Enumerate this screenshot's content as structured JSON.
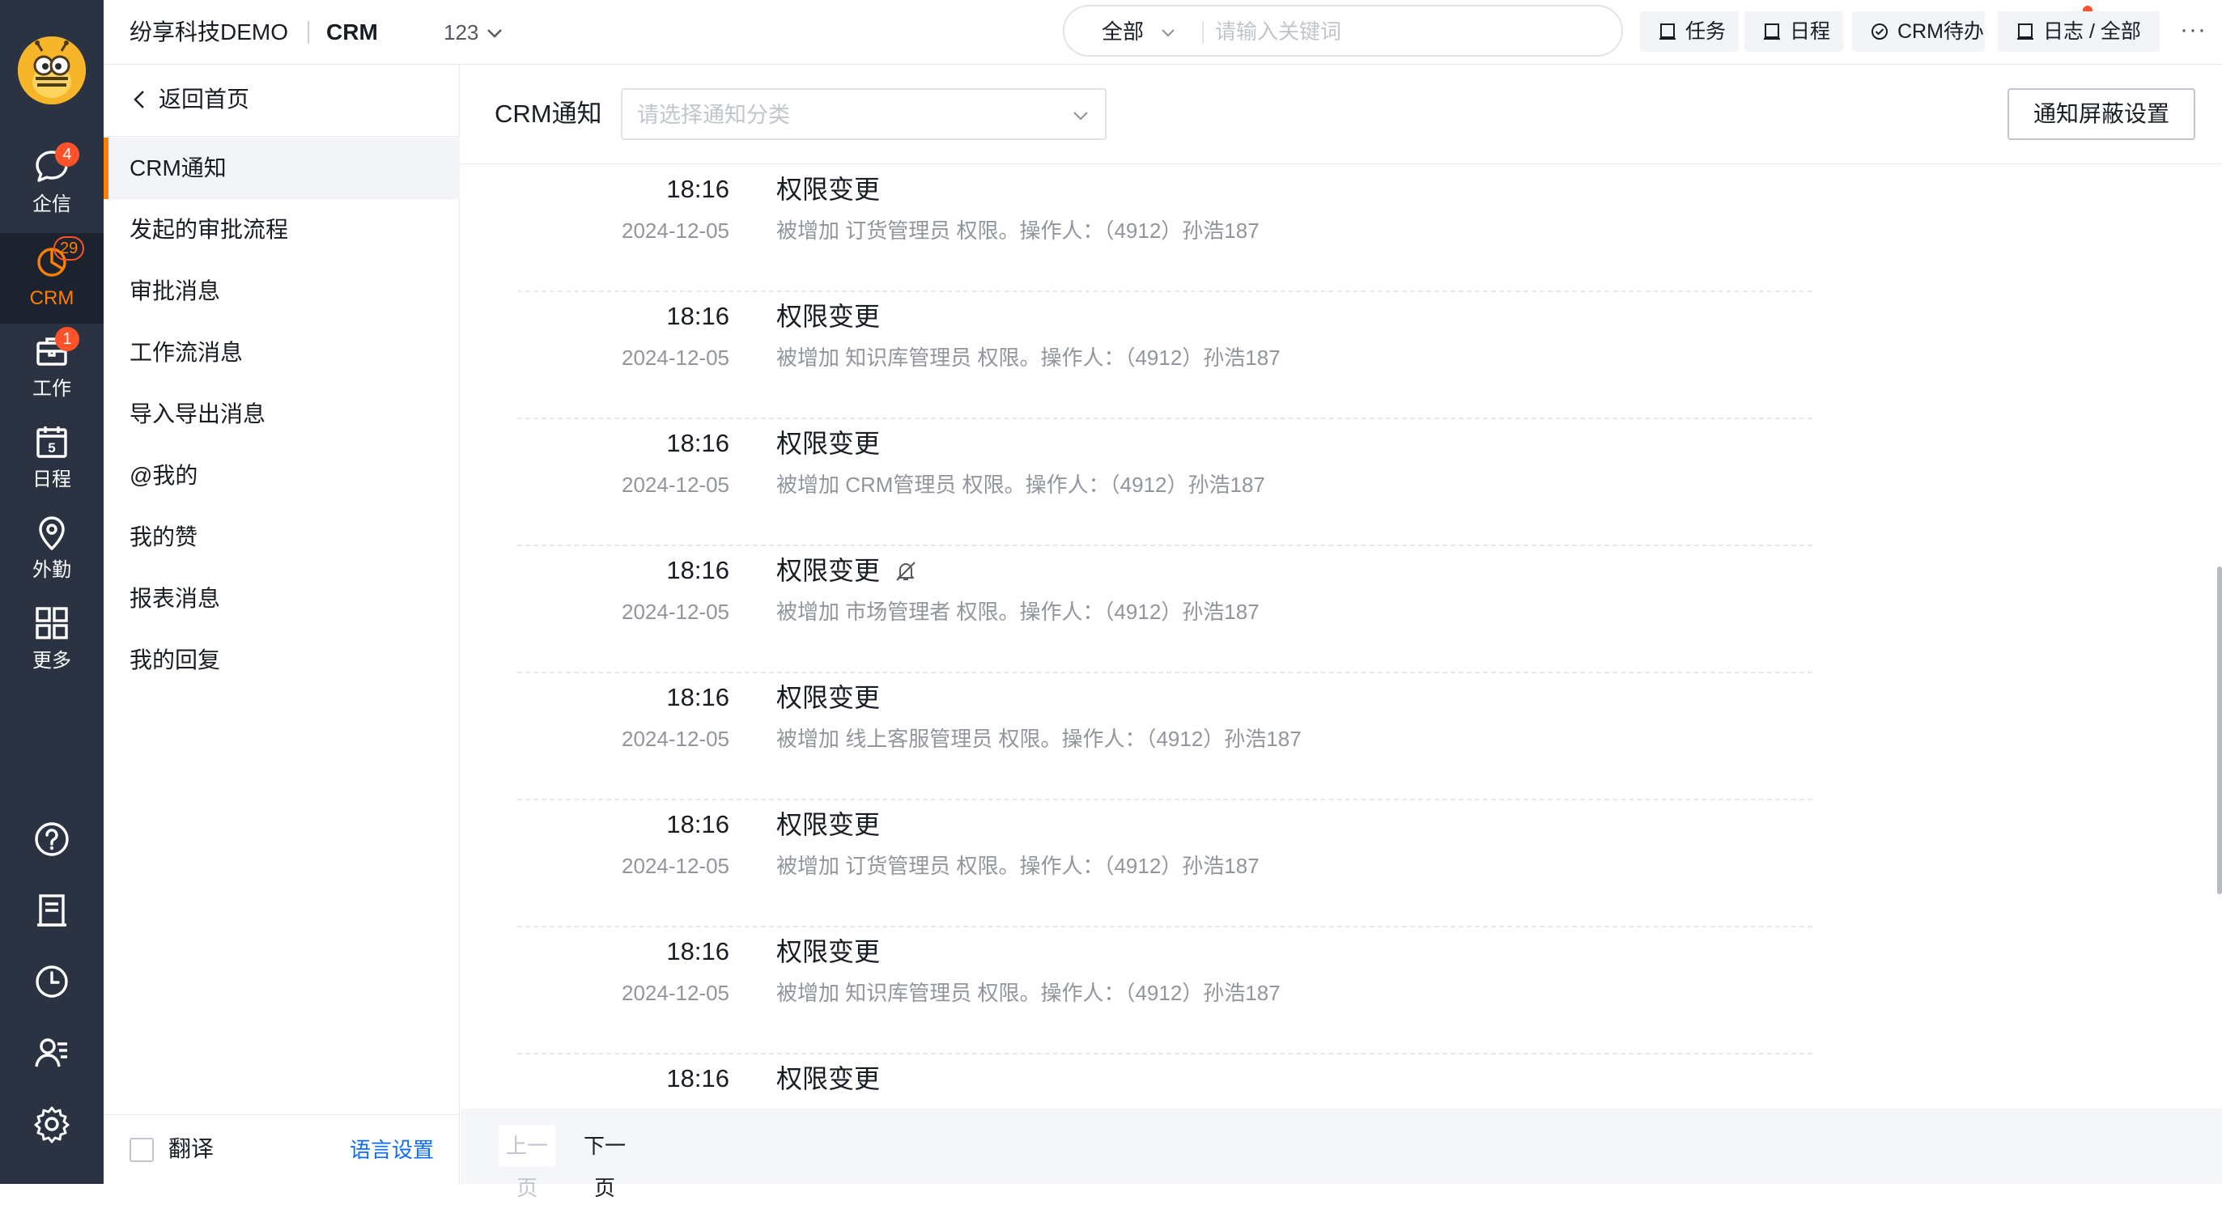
{
  "header": {
    "company": "纷享科技DEMO",
    "module": "CRM",
    "env": "123",
    "search": {
      "scope": "全部",
      "placeholder": "请输入关键词"
    },
    "chips": [
      {
        "label": "任务",
        "icon": "task-icon"
      },
      {
        "label": "日程",
        "icon": "schedule-icon"
      },
      {
        "label": "CRM待办",
        "icon": "todo-check-icon"
      },
      {
        "label": "日志 / 全部",
        "icon": "log-icon"
      }
    ],
    "more": "···"
  },
  "rail": {
    "items": [
      {
        "label": "企信",
        "badge": "4",
        "icon": "chat-bubble-icon"
      },
      {
        "label": "CRM",
        "badge": "29",
        "icon": "crm-pie-icon",
        "active": true
      },
      {
        "label": "工作",
        "badge": "1",
        "icon": "briefcase-icon"
      },
      {
        "label": "日程",
        "icon": "calendar-icon",
        "calendar_day": "5"
      },
      {
        "label": "外勤",
        "icon": "location-pin-icon"
      },
      {
        "label": "更多",
        "icon": "grid-apps-icon"
      }
    ],
    "tools": [
      "help-icon",
      "notebook-icon",
      "clock-icon",
      "contacts-icon",
      "settings-gear-icon"
    ]
  },
  "sidebar": {
    "back": "返回首页",
    "items": [
      {
        "label": "CRM通知",
        "active": true
      },
      {
        "label": "发起的审批流程"
      },
      {
        "label": "审批消息"
      },
      {
        "label": "工作流消息"
      },
      {
        "label": "导入导出消息"
      },
      {
        "label": "@我的"
      },
      {
        "label": "我的赞"
      },
      {
        "label": "报表消息"
      },
      {
        "label": "我的回复"
      }
    ],
    "translate_label": "翻译",
    "translate_checked": false,
    "language_link": "语言设置"
  },
  "main": {
    "title": "CRM通知",
    "category_placeholder": "请选择通知分类",
    "mute_settings_button": "通知屏蔽设置",
    "notifications": [
      {
        "time": "18:16",
        "date": "2024-12-05",
        "title": "权限变更",
        "desc": "被增加 订货管理员 权限。操作人：（4912）孙浩187",
        "muted": false
      },
      {
        "time": "18:16",
        "date": "2024-12-05",
        "title": "权限变更",
        "desc": "被增加 知识库管理员 权限。操作人：（4912）孙浩187",
        "muted": false
      },
      {
        "time": "18:16",
        "date": "2024-12-05",
        "title": "权限变更",
        "desc": "被增加 CRM管理员 权限。操作人：（4912）孙浩187",
        "muted": false
      },
      {
        "time": "18:16",
        "date": "2024-12-05",
        "title": "权限变更",
        "desc": "被增加 市场管理者 权限。操作人：（4912）孙浩187",
        "muted": true
      },
      {
        "time": "18:16",
        "date": "2024-12-05",
        "title": "权限变更",
        "desc": "被增加 线上客服管理员 权限。操作人：（4912）孙浩187",
        "muted": false
      },
      {
        "time": "18:16",
        "date": "2024-12-05",
        "title": "权限变更",
        "desc": "被增加 订货管理员 权限。操作人：（4912）孙浩187",
        "muted": false
      },
      {
        "time": "18:16",
        "date": "2024-12-05",
        "title": "权限变更",
        "desc": "被增加 知识库管理员 权限。操作人：（4912）孙浩187",
        "muted": false
      },
      {
        "time": "18:16",
        "date": "",
        "title": "权限变更",
        "desc": "",
        "muted": false
      }
    ],
    "pager": {
      "prev": "上一页",
      "next": "下一页"
    }
  },
  "colors": {
    "accent": "#ff8000",
    "rail_bg": "#2b3343",
    "badge": "#ff522a",
    "link": "#0c6cff"
  }
}
